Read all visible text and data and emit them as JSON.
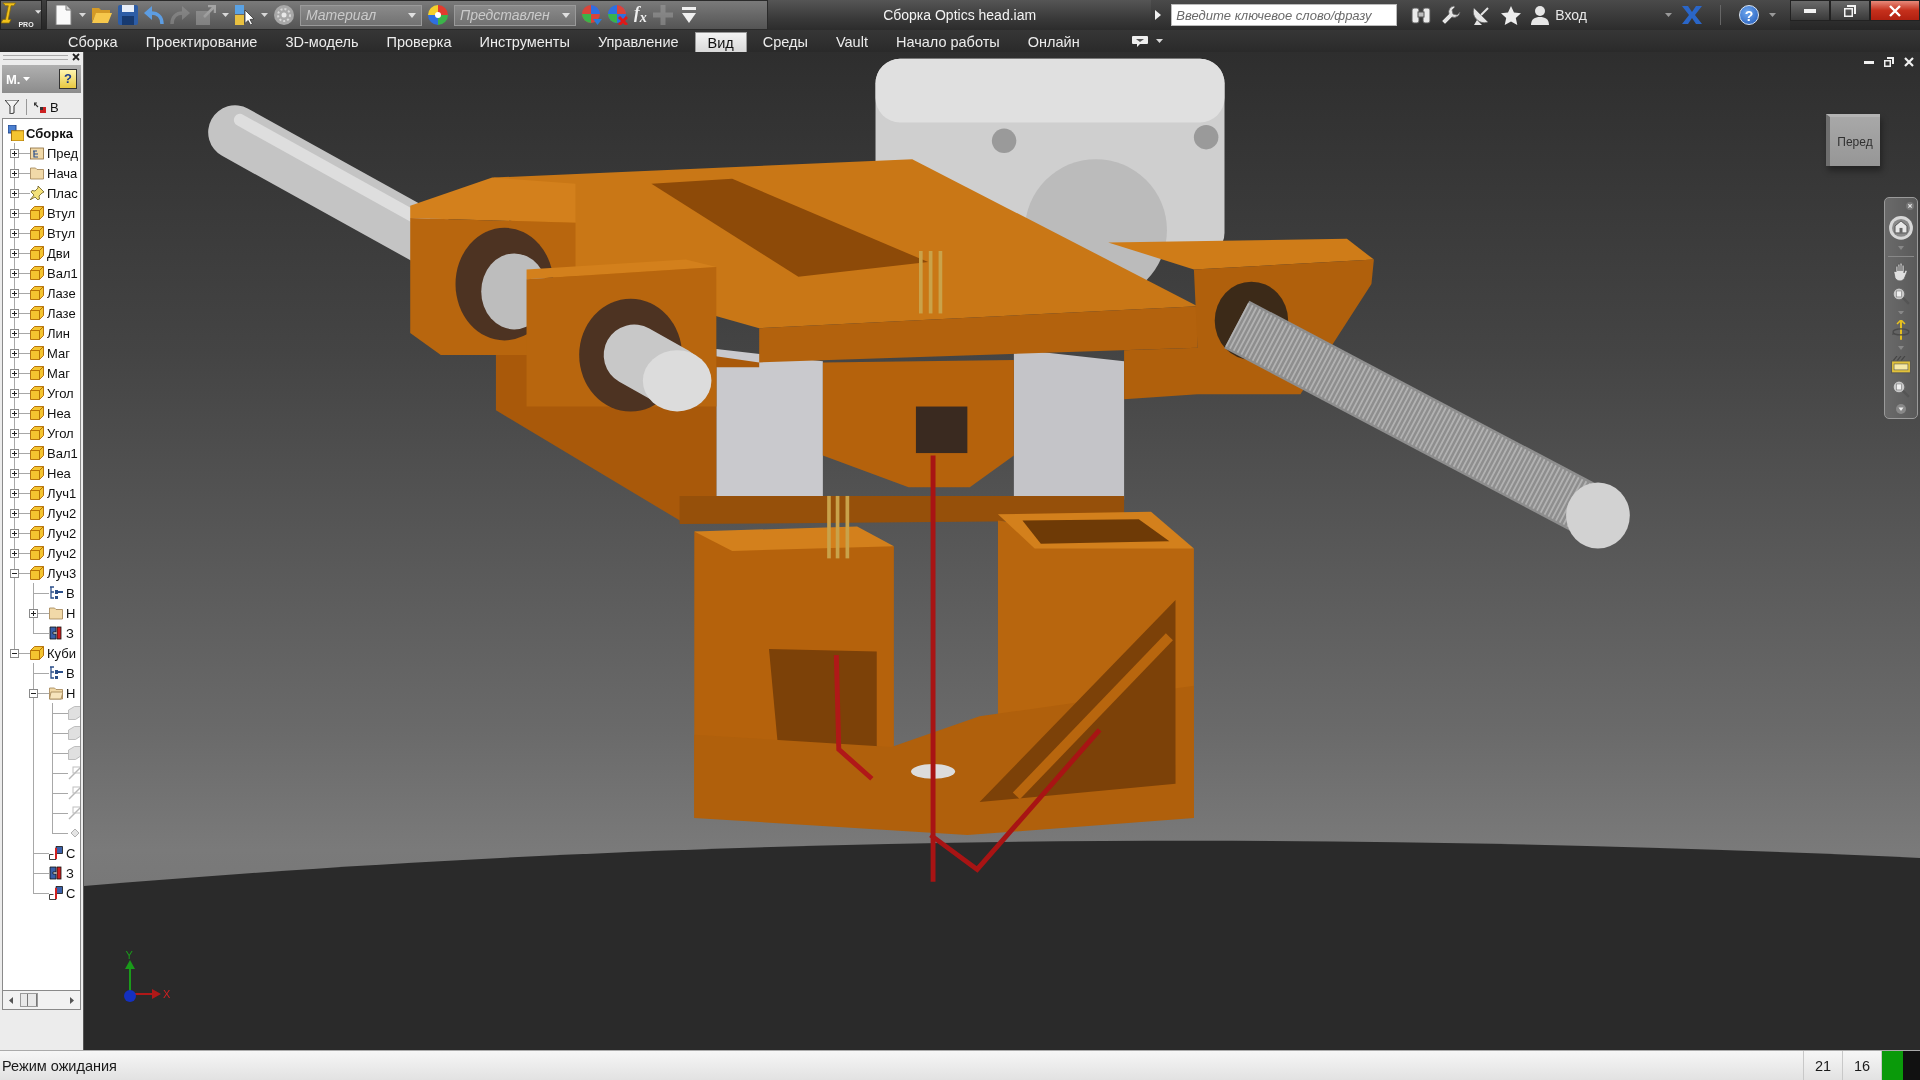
{
  "title_bar": {
    "logo_badge": "PRO",
    "quick_access": [
      {
        "kind": "new",
        "disabled": false
      },
      {
        "kind": "caret",
        "disabled": false
      },
      {
        "kind": "open",
        "disabled": false
      },
      {
        "kind": "save",
        "disabled": false
      },
      {
        "kind": "undo",
        "disabled": false
      },
      {
        "kind": "redo",
        "disabled": true
      },
      {
        "kind": "return",
        "disabled": true
      },
      {
        "kind": "caret",
        "disabled": false
      },
      {
        "kind": "select",
        "disabled": false
      },
      {
        "kind": "caret",
        "disabled": false
      },
      {
        "kind": "sphere",
        "disabled": false
      },
      {
        "kind": "combo",
        "value": "Материал",
        "disabled": false
      },
      {
        "kind": "color-wheel",
        "disabled": false
      },
      {
        "kind": "combo",
        "value": "Представлен",
        "disabled": false
      },
      {
        "kind": "adjust",
        "disabled": false
      },
      {
        "kind": "clear",
        "disabled": false
      },
      {
        "kind": "function",
        "label": "f$_{x}$",
        "disabled": false
      },
      {
        "kind": "plus",
        "disabled": true
      },
      {
        "kind": "overflow",
        "disabled": false
      }
    ],
    "title": "Сборка Optics head.iam",
    "search": {
      "placeholder": "Введите ключевое слово/фразу"
    },
    "sign_in": "Вход",
    "help": "?"
  },
  "ribbon_tabs": [
    {
      "label": "Сборка",
      "selected": false
    },
    {
      "label": "Проектирование",
      "selected": false
    },
    {
      "label": "3D-модель",
      "selected": false
    },
    {
      "label": "Проверка",
      "selected": false
    },
    {
      "label": "Инструменты",
      "selected": false
    },
    {
      "label": "Управление",
      "selected": false
    },
    {
      "label": "Вид",
      "selected": true
    },
    {
      "label": "Среды",
      "selected": false
    },
    {
      "label": "Vault",
      "selected": false
    },
    {
      "label": "Начало работы",
      "selected": false
    },
    {
      "label": "Онлайн",
      "selected": false
    }
  ],
  "browser": {
    "menu_button": "М.",
    "help": "?",
    "view_label": "В",
    "tree": {
      "label": "Сборка",
      "kind": "assembly",
      "children": [
        {
          "label": "Пред",
          "kind": "representations",
          "expanded": false
        },
        {
          "label": "Нача",
          "kind": "folder",
          "expanded": false
        },
        {
          "label": "Плас",
          "kind": "pin",
          "expanded": false
        },
        {
          "label": "Втул",
          "kind": "part",
          "expanded": false
        },
        {
          "label": "Втул",
          "kind": "part",
          "expanded": false
        },
        {
          "label": "Дви",
          "kind": "part",
          "expanded": false
        },
        {
          "label": "Вал1",
          "kind": "part",
          "expanded": false
        },
        {
          "label": "Лазе",
          "kind": "part",
          "expanded": false
        },
        {
          "label": "Лазе",
          "kind": "part",
          "expanded": false
        },
        {
          "label": "Лин",
          "kind": "part",
          "expanded": false
        },
        {
          "label": "Маг",
          "kind": "part",
          "expanded": false
        },
        {
          "label": "Маг",
          "kind": "part",
          "expanded": false
        },
        {
          "label": "Угол",
          "kind": "part",
          "expanded": false
        },
        {
          "label": "Hea",
          "kind": "part",
          "expanded": false
        },
        {
          "label": "Угол",
          "kind": "part",
          "expanded": false
        },
        {
          "label": "Вал1",
          "kind": "part",
          "expanded": false
        },
        {
          "label": "Hea",
          "kind": "part",
          "expanded": false
        },
        {
          "label": "Луч1",
          "kind": "part",
          "expanded": false
        },
        {
          "label": "Луч2",
          "kind": "part",
          "expanded": false
        },
        {
          "label": "Луч2",
          "kind": "part",
          "expanded": false
        },
        {
          "label": "Луч2",
          "kind": "part",
          "expanded": false
        },
        {
          "label": "Луч3",
          "kind": "part",
          "expanded": true,
          "children": [
            {
              "label": "В",
              "kind": "view-rep"
            },
            {
              "label": "Н",
              "kind": "folder",
              "expanded": false
            },
            {
              "label": "З",
              "kind": "mate"
            }
          ]
        },
        {
          "label": "Куби",
          "kind": "part",
          "expanded": true,
          "children": [
            {
              "label": "В",
              "kind": "view-rep"
            },
            {
              "label": "Н",
              "kind": "folder",
              "expanded": true,
              "children": [
                {
                  "kind": "plane"
                },
                {
                  "kind": "plane"
                },
                {
                  "kind": "plane"
                },
                {
                  "kind": "axis"
                },
                {
                  "kind": "axis"
                },
                {
                  "kind": "axis"
                },
                {
                  "kind": "point"
                }
              ]
            },
            {
              "label": "С",
              "kind": "joint"
            },
            {
              "label": "З",
              "kind": "mate"
            },
            {
              "label": "С",
              "kind": "joint"
            }
          ]
        }
      ]
    }
  },
  "viewport": {
    "viewcube_face": "Перед",
    "axis_x": "X",
    "axis_y": "Y"
  },
  "status_bar": {
    "message": "Режим ожидания",
    "counts": [
      "21",
      "16"
    ]
  }
}
